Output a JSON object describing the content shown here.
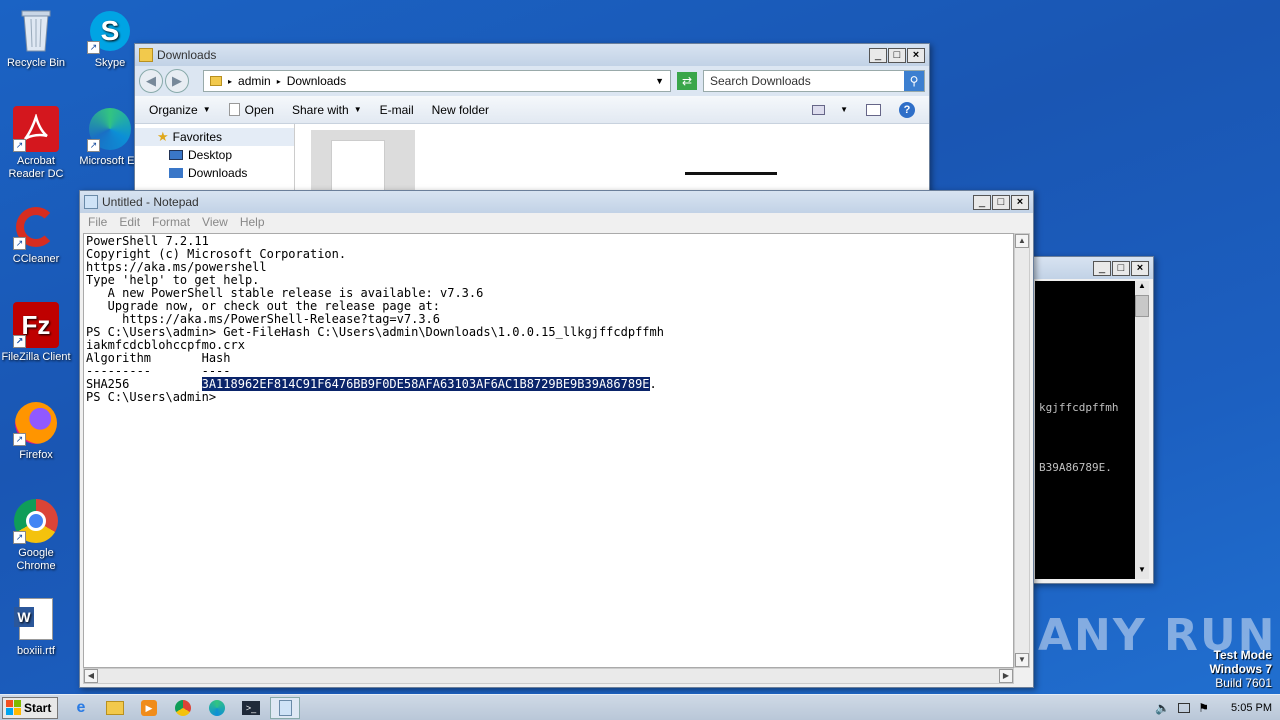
{
  "desktop": {
    "icons": [
      {
        "label": "Recycle Bin",
        "icon": "recycle-bin-icon"
      },
      {
        "label": "Skype",
        "icon": "skype-icon"
      },
      {
        "label": "Acrobat Reader DC",
        "icon": "acrobat-icon"
      },
      {
        "label": "Microsoft Ed",
        "icon": "edge-icon"
      },
      {
        "label": "CCleaner",
        "icon": "ccleaner-icon"
      },
      {
        "label": "FileZilla Client",
        "icon": "filezilla-icon"
      },
      {
        "label": "Firefox",
        "icon": "firefox-icon"
      },
      {
        "label": "Google Chrome",
        "icon": "chrome-icon"
      },
      {
        "label": "boxiii.rtf",
        "icon": "word-document-icon"
      }
    ],
    "watermark": {
      "line1": "Test Mode",
      "line2": "Windows 7",
      "line3": "Build 7601"
    },
    "anyrun_logo": "ANY RUN"
  },
  "explorer": {
    "title": "Downloads",
    "breadcrumb": [
      "admin",
      "Downloads"
    ],
    "search_placeholder": "Search Downloads",
    "toolbar": {
      "organize": "Organize",
      "open": "Open",
      "share_with": "Share with",
      "email": "E-mail",
      "new_folder": "New folder"
    },
    "nav": {
      "favorites": "Favorites",
      "desktop": "Desktop",
      "downloads": "Downloads"
    }
  },
  "console": {
    "fragment1": "kgjffcdpffmh",
    "fragment2": "B39A86789E."
  },
  "notepad": {
    "title": "Untitled - Notepad",
    "menu": [
      "File",
      "Edit",
      "Format",
      "View",
      "Help"
    ],
    "lines": [
      "PowerShell 7.2.11",
      "Copyright (c) Microsoft Corporation.",
      "",
      "https://aka.ms/powershell",
      "Type 'help' to get help.",
      "",
      "   A new PowerShell stable release is available: v7.3.6",
      "   Upgrade now, or check out the release page at:",
      "     https://aka.ms/PowerShell-Release?tag=v7.3.6",
      "",
      "PS C:\\Users\\admin> Get-FileHash C:\\Users\\admin\\Downloads\\1.0.0.15_llkgjffcdpffmh",
      "iakmfcdcblohccpfmo.crx",
      "",
      "Algorithm       Hash",
      "---------       ----"
    ],
    "hash_row_prefix": "SHA256          ",
    "hash_selected": "3A118962EF814C91F6476BB9F0DE58AFA63103AF6AC1B8729BE9B39A86789E",
    "hash_suffix": ".",
    "prompt_lines": [
      "",
      "PS C:\\Users\\admin>"
    ]
  },
  "taskbar": {
    "start_label": "Start",
    "clock": "5:05 PM"
  }
}
